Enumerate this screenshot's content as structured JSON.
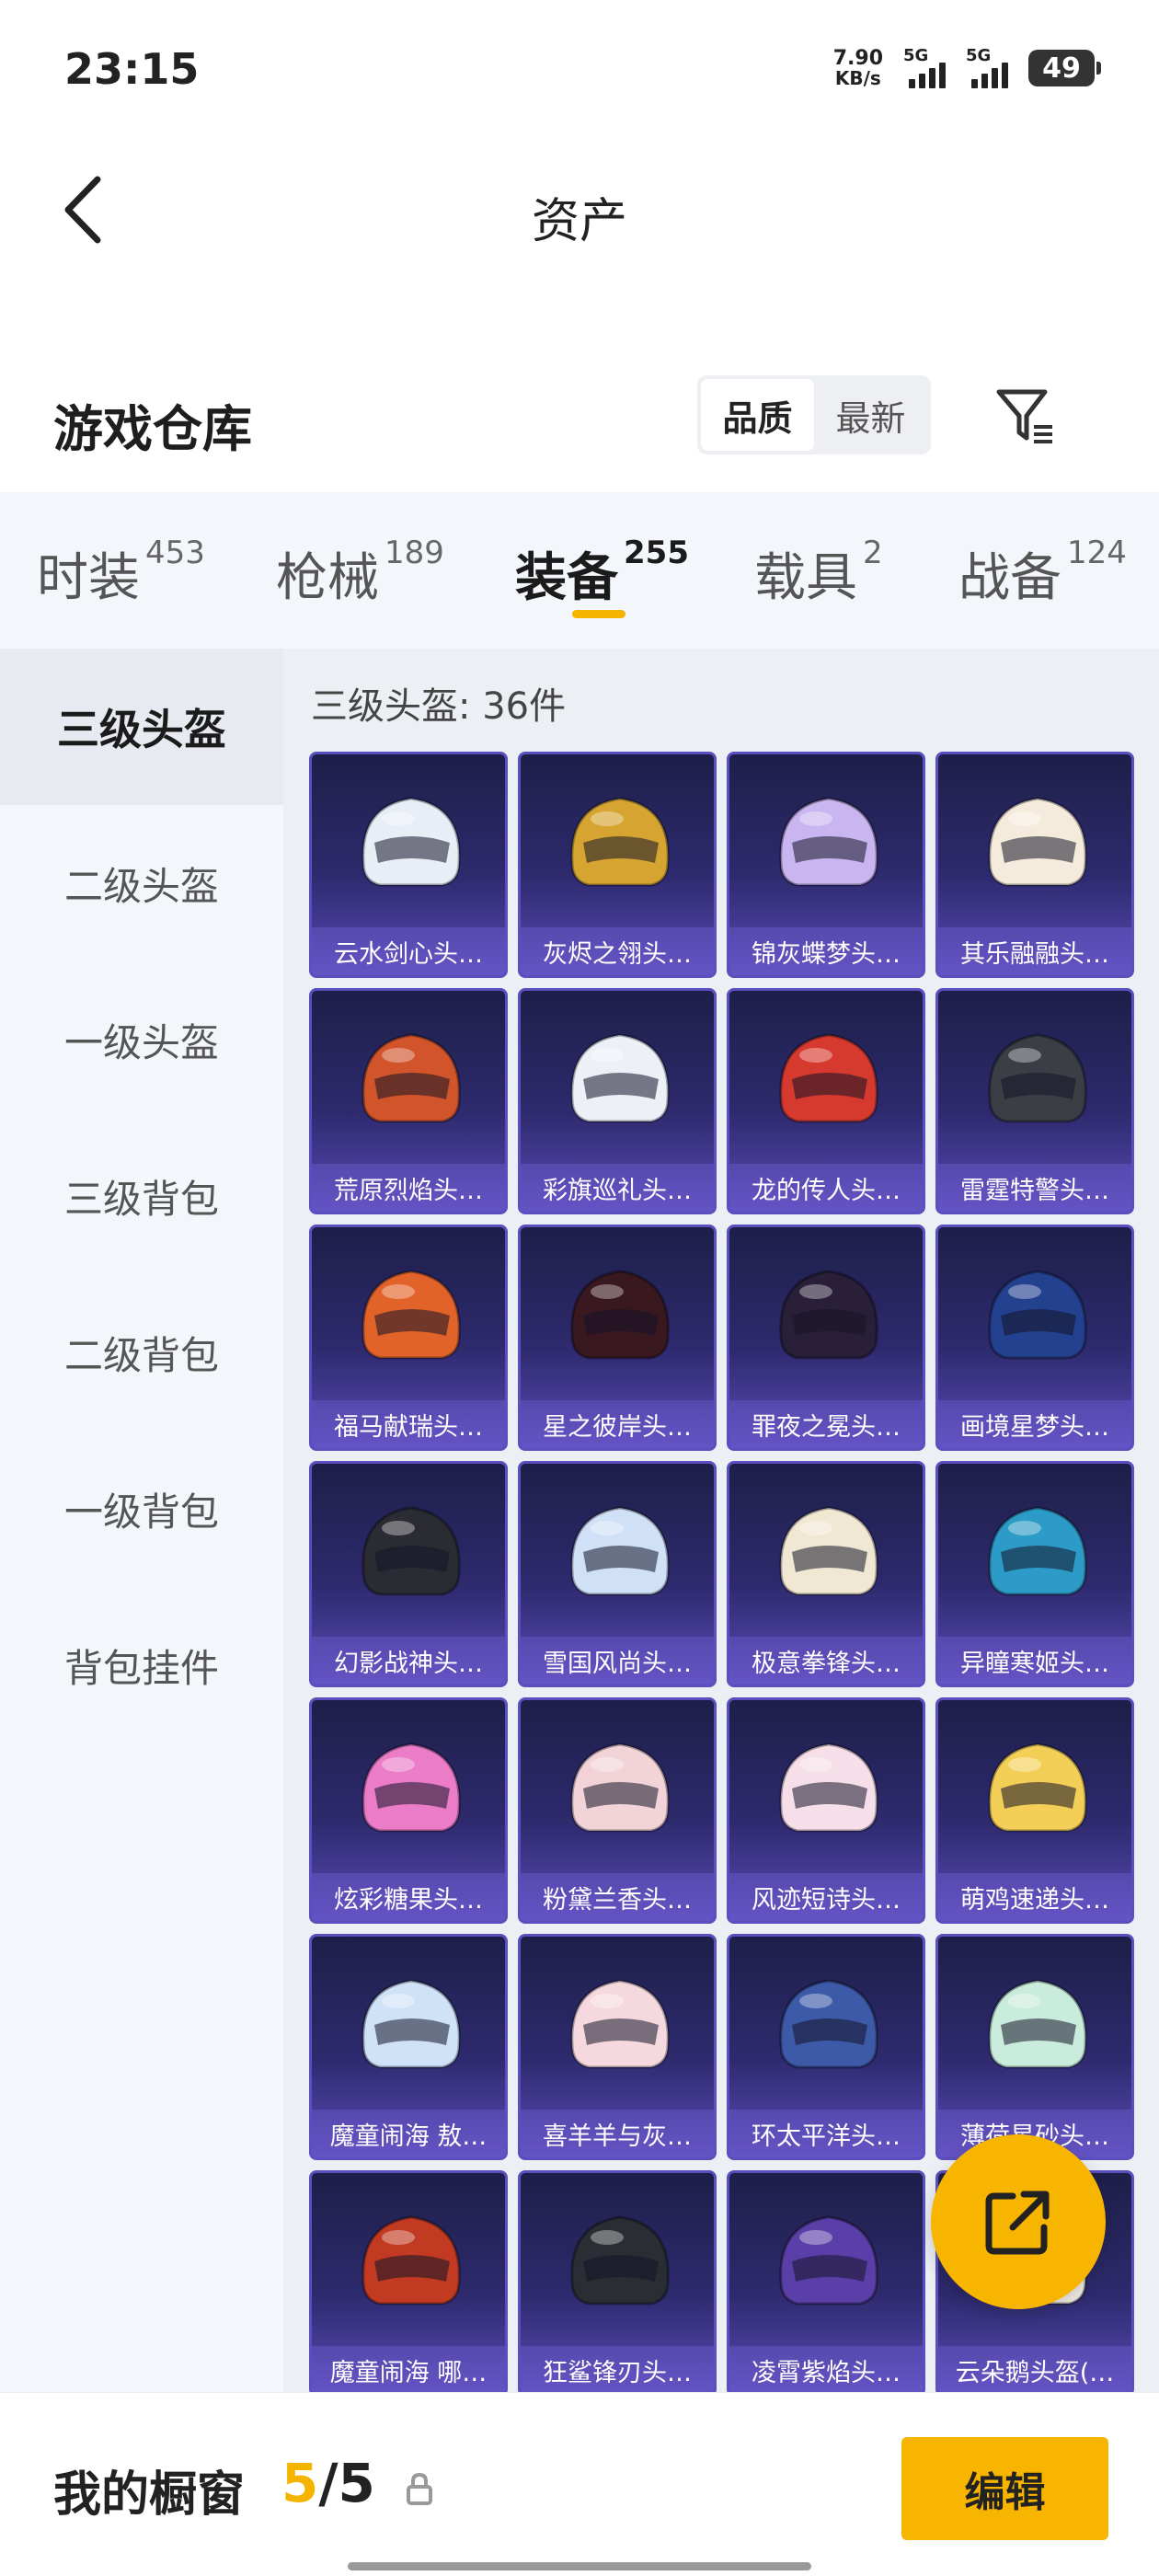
{
  "status": {
    "time": "23:15",
    "net_speed_value": "7.90",
    "net_speed_unit": "KB/s",
    "sim1": "5G",
    "sim2": "5G",
    "battery": "49"
  },
  "header": {
    "title": "资产",
    "back_icon": "back-arrow-icon"
  },
  "section": {
    "title": "游戏仓库",
    "sort_options": [
      "品质",
      "最新"
    ],
    "sort_active": "品质",
    "filter_icon": "filter-icon"
  },
  "category_tabs": [
    {
      "label": "时装",
      "count": "453"
    },
    {
      "label": "枪械",
      "count": "189"
    },
    {
      "label": "装备",
      "count": "255",
      "active": true
    },
    {
      "label": "载具",
      "count": "2"
    },
    {
      "label": "战备",
      "count": "124"
    }
  ],
  "sidebar": {
    "items": [
      "三级头盔",
      "二级头盔",
      "一级头盔",
      "三级背包",
      "二级背包",
      "一级背包",
      "背包挂件"
    ],
    "active": "三级头盔"
  },
  "content": {
    "title": "三级头盔: 36件",
    "items": [
      {
        "name": "云水剑心头…",
        "color": "#e8eef5"
      },
      {
        "name": "灰烬之翎头…",
        "color": "#d6a531"
      },
      {
        "name": "锦灰蝶梦头…",
        "color": "#c9b6f0"
      },
      {
        "name": "其乐融融头…",
        "color": "#f4ebdc"
      },
      {
        "name": "荒原烈焰头…",
        "color": "#d2542a"
      },
      {
        "name": "彩旗巡礼头…",
        "color": "#eef0f8"
      },
      {
        "name": "龙的传人头…",
        "color": "#d63a2e"
      },
      {
        "name": "雷霆特警头…",
        "color": "#3b3f45"
      },
      {
        "name": "福马献瑞头…",
        "color": "#e2632a"
      },
      {
        "name": "星之彼岸头…",
        "color": "#3a1820"
      },
      {
        "name": "罪夜之冕头…",
        "color": "#2a1f38"
      },
      {
        "name": "画境星梦头…",
        "color": "#24418f"
      },
      {
        "name": "幻影战神头…",
        "color": "#2b2b33"
      },
      {
        "name": "雪国风尚头…",
        "color": "#cfe0f7"
      },
      {
        "name": "极意拳锋头…",
        "color": "#f0e8d2"
      },
      {
        "name": "异瞳寒姬头…",
        "color": "#2d9bc7"
      },
      {
        "name": "炫彩糖果头…",
        "color": "#ea7cc8"
      },
      {
        "name": "粉黛兰香头…",
        "color": "#f1d3d8"
      },
      {
        "name": "风迹短诗头…",
        "color": "#f6dfe8"
      },
      {
        "name": "萌鸡速递头…",
        "color": "#f4cf57"
      },
      {
        "name": "魔童闹海 敖…",
        "color": "#cfe2f8"
      },
      {
        "name": "喜羊羊与灰…",
        "color": "#f6d9df"
      },
      {
        "name": "环太平洋头…",
        "color": "#3d5aa8"
      },
      {
        "name": "薄荷星砂头…",
        "color": "#c9ecdd"
      },
      {
        "name": "魔童闹海 哪…",
        "color": "#c23a22"
      },
      {
        "name": "狂鲨锋刃头…",
        "color": "#2a2d33"
      },
      {
        "name": "凌霄紫焰头…",
        "color": "#5b3fa8"
      },
      {
        "name": "云朵鹅头盔(…",
        "color": "#f4efe6"
      }
    ]
  },
  "fab": {
    "icon": "share-external-icon"
  },
  "bottom": {
    "showcase_label": "我的橱窗",
    "current": "5",
    "separator": "/",
    "total": "5",
    "lock_icon": "lock-icon",
    "edit_label": "编辑"
  }
}
